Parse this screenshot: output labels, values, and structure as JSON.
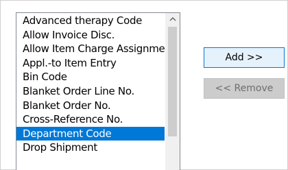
{
  "field_list": {
    "items": [
      {
        "label": "Advanced therapy Code",
        "selected": false
      },
      {
        "label": "Allow Invoice Disc.",
        "selected": false
      },
      {
        "label": "Allow Item Charge Assignment",
        "selected": false
      },
      {
        "label": "Appl.-to Item Entry",
        "selected": false
      },
      {
        "label": "Bin Code",
        "selected": false
      },
      {
        "label": "Blanket Order Line No.",
        "selected": false
      },
      {
        "label": "Blanket Order No.",
        "selected": false
      },
      {
        "label": "Cross-Reference No.",
        "selected": false
      },
      {
        "label": "Department Code",
        "selected": true
      },
      {
        "label": "Drop Shipment",
        "selected": false
      }
    ],
    "scroll_up_icon": "chevron-up-icon"
  },
  "buttons": {
    "add_label": "Add >>",
    "remove_label": "<< Remove",
    "remove_enabled": false
  },
  "colors": {
    "selection": "#0078d7",
    "add_button_bg": "#e5f1fb",
    "add_button_border": "#0078d7",
    "disabled_button_bg": "#cccccc",
    "disabled_text": "#6d6d6d"
  }
}
